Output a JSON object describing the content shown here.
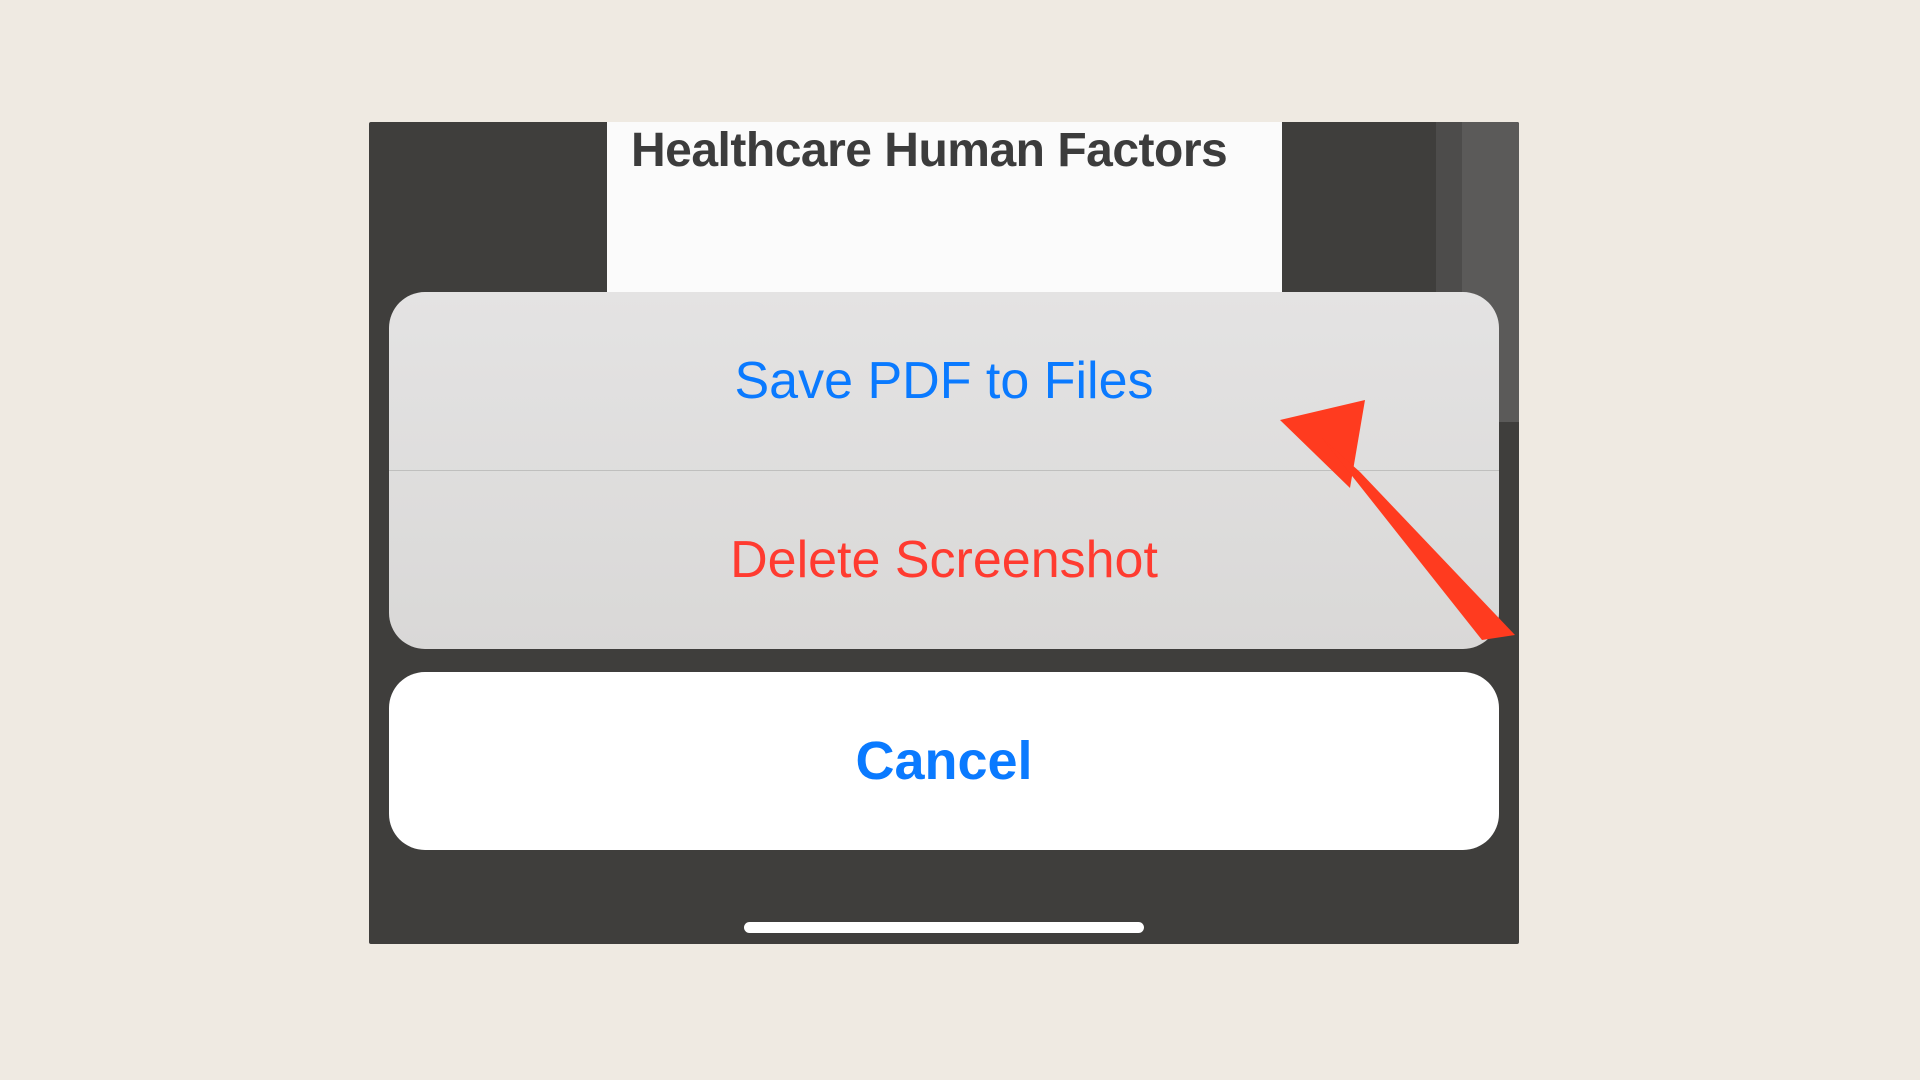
{
  "background": {
    "card_title": "Healthcare Human Factors"
  },
  "action_sheet": {
    "options": [
      {
        "label": "Save PDF to Files",
        "style": "blue"
      },
      {
        "label": "Delete Screenshot",
        "style": "red"
      }
    ],
    "cancel_label": "Cancel"
  },
  "colors": {
    "page_bg": "#efeae2",
    "phone_bg": "#3f3e3c",
    "sheet_bg_top": "#e4e3e3",
    "sheet_bg_bottom": "#d9d8d7",
    "cancel_bg": "#ffffff",
    "ios_blue": "#0a7aff",
    "ios_red": "#ff3b30",
    "annotation_red": "#ff3b1f"
  }
}
